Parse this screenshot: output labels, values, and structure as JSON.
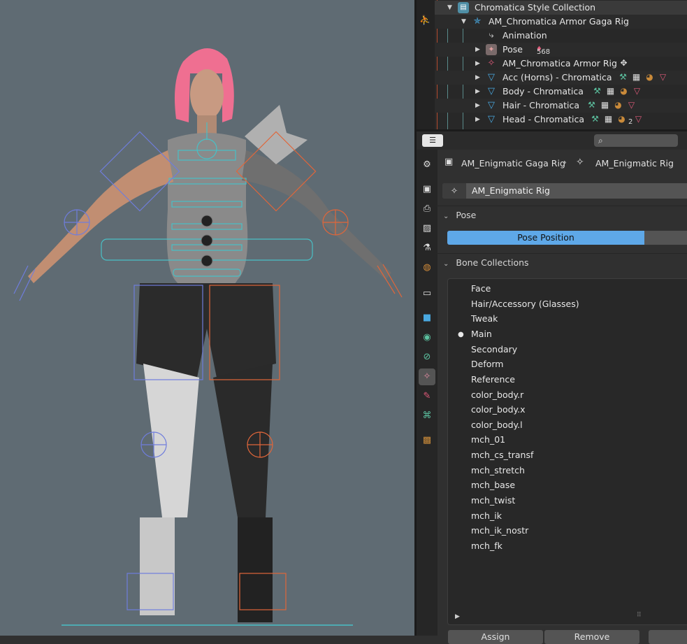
{
  "outliner": {
    "rows": [
      {
        "label": "Chromatica Style Collection",
        "icon": "collection-icon"
      },
      {
        "label": "AM_Chromatica Armor Gaga Rig",
        "icon": "armature-object-icon"
      },
      {
        "label": "Animation",
        "icon": "animation-icon"
      },
      {
        "label": "Pose",
        "icon": "pose-icon",
        "count": "568"
      },
      {
        "label": "AM_Chromatica Armor Rig",
        "icon": "armature-data-icon"
      },
      {
        "label": "Acc (Horns) - Chromatica",
        "icon": "mesh-icon"
      },
      {
        "label": "Body - Chromatica",
        "icon": "mesh-icon"
      },
      {
        "label": "Hair - Chromatica",
        "icon": "mesh-icon"
      },
      {
        "label": "Head - Chromatica",
        "icon": "mesh-icon",
        "count": "2"
      }
    ]
  },
  "properties": {
    "search_placeholder": "",
    "breadcrumb": {
      "object": "AM_Enigmatic Gaga Rig",
      "data": "AM_Enigmatic Rig"
    },
    "datablock_name": "AM_Enigmatic Rig",
    "pose_section": {
      "title": "Pose",
      "pose_position_label": "Pose Position"
    },
    "bone_collections": {
      "title": "Bone Collections",
      "items": [
        "Face",
        "Hair/Accessory (Glasses)",
        "Tweak",
        "Main",
        "Secondary",
        "Deform",
        "Reference",
        "color_body.r",
        "color_body.x",
        "color_body.l",
        "mch_01",
        "mch_cs_transf",
        "mch_stretch",
        "mch_base",
        "mch_twist",
        "mch_ik",
        "mch_ik_nostr",
        "mch_fk"
      ],
      "active": "Main"
    },
    "buttons": {
      "assign": "Assign",
      "remove": "Remove"
    }
  },
  "colors": {
    "accent_blue": "#5ea8e8",
    "viewport_bg": "#5f6b73",
    "bone_left": "#6f7ddc",
    "bone_right": "#e0663a",
    "bone_center": "#49c0c6"
  }
}
